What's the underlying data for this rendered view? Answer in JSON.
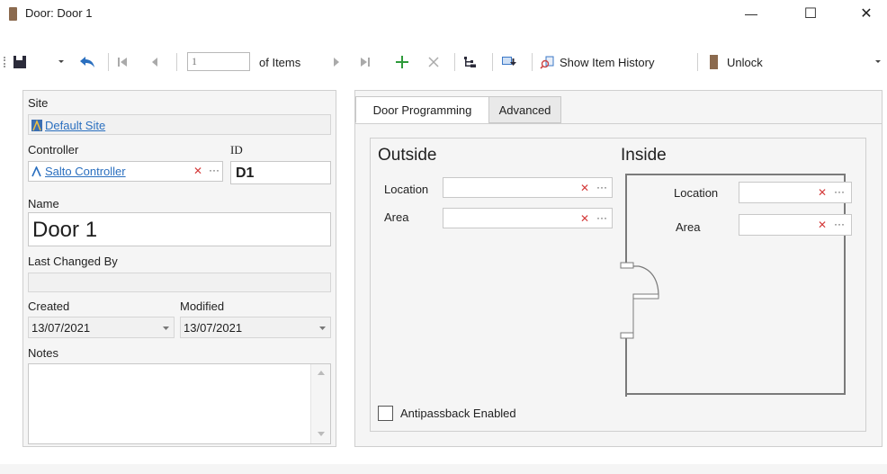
{
  "window": {
    "title": "Door: Door 1",
    "minimize_glyph": "—",
    "maximize_glyph": "☐",
    "close_glyph": "✕"
  },
  "toolbar": {
    "position_value": "1",
    "of_items_label": "of Items",
    "show_history_label": "Show Item History",
    "unlock_label": "Unlock",
    "icons": [
      "save-icon",
      "dropdown-arrow-icon",
      "undo-icon",
      "first-record-icon",
      "previous-record-icon",
      "next-record-icon",
      "last-record-icon",
      "add-icon",
      "delete-icon",
      "hierarchy-icon",
      "export-icon",
      "history-icon",
      "door-icon",
      "overflow-chevron-icon"
    ]
  },
  "form": {
    "site_label": "Site",
    "site_value": "Default Site",
    "controller_label": "Controller",
    "controller_value": "Salto Controller",
    "id_label": "ID",
    "id_value": "D1",
    "name_label": "Name",
    "name_value": "Door 1",
    "last_changed_label": "Last Changed By",
    "last_changed_value": "",
    "created_label": "Created",
    "created_value": "13/07/2021",
    "modified_label": "Modified",
    "modified_value": "13/07/2021",
    "notes_label": "Notes",
    "notes_value": "",
    "clear_glyph": "✕",
    "browse_glyph": "···"
  },
  "tabs": [
    {
      "label": "Door Programming",
      "active": true
    },
    {
      "label": "Advanced",
      "active": false
    }
  ],
  "door_programming": {
    "outside_title": "Outside",
    "inside_title": "Inside",
    "outside_location_label": "Location",
    "outside_area_label": "Area",
    "inside_location_label": "Location",
    "inside_area_label": "Area",
    "antipassback_label": "Antipassback Enabled",
    "antipassback_checked": false
  },
  "colors": {
    "link": "#2a6fbf",
    "clear_x": "#d43b3b",
    "add_green": "#2e9a3a",
    "undo_blue": "#2a6fbf",
    "door_brown": "#8b6a4e"
  }
}
